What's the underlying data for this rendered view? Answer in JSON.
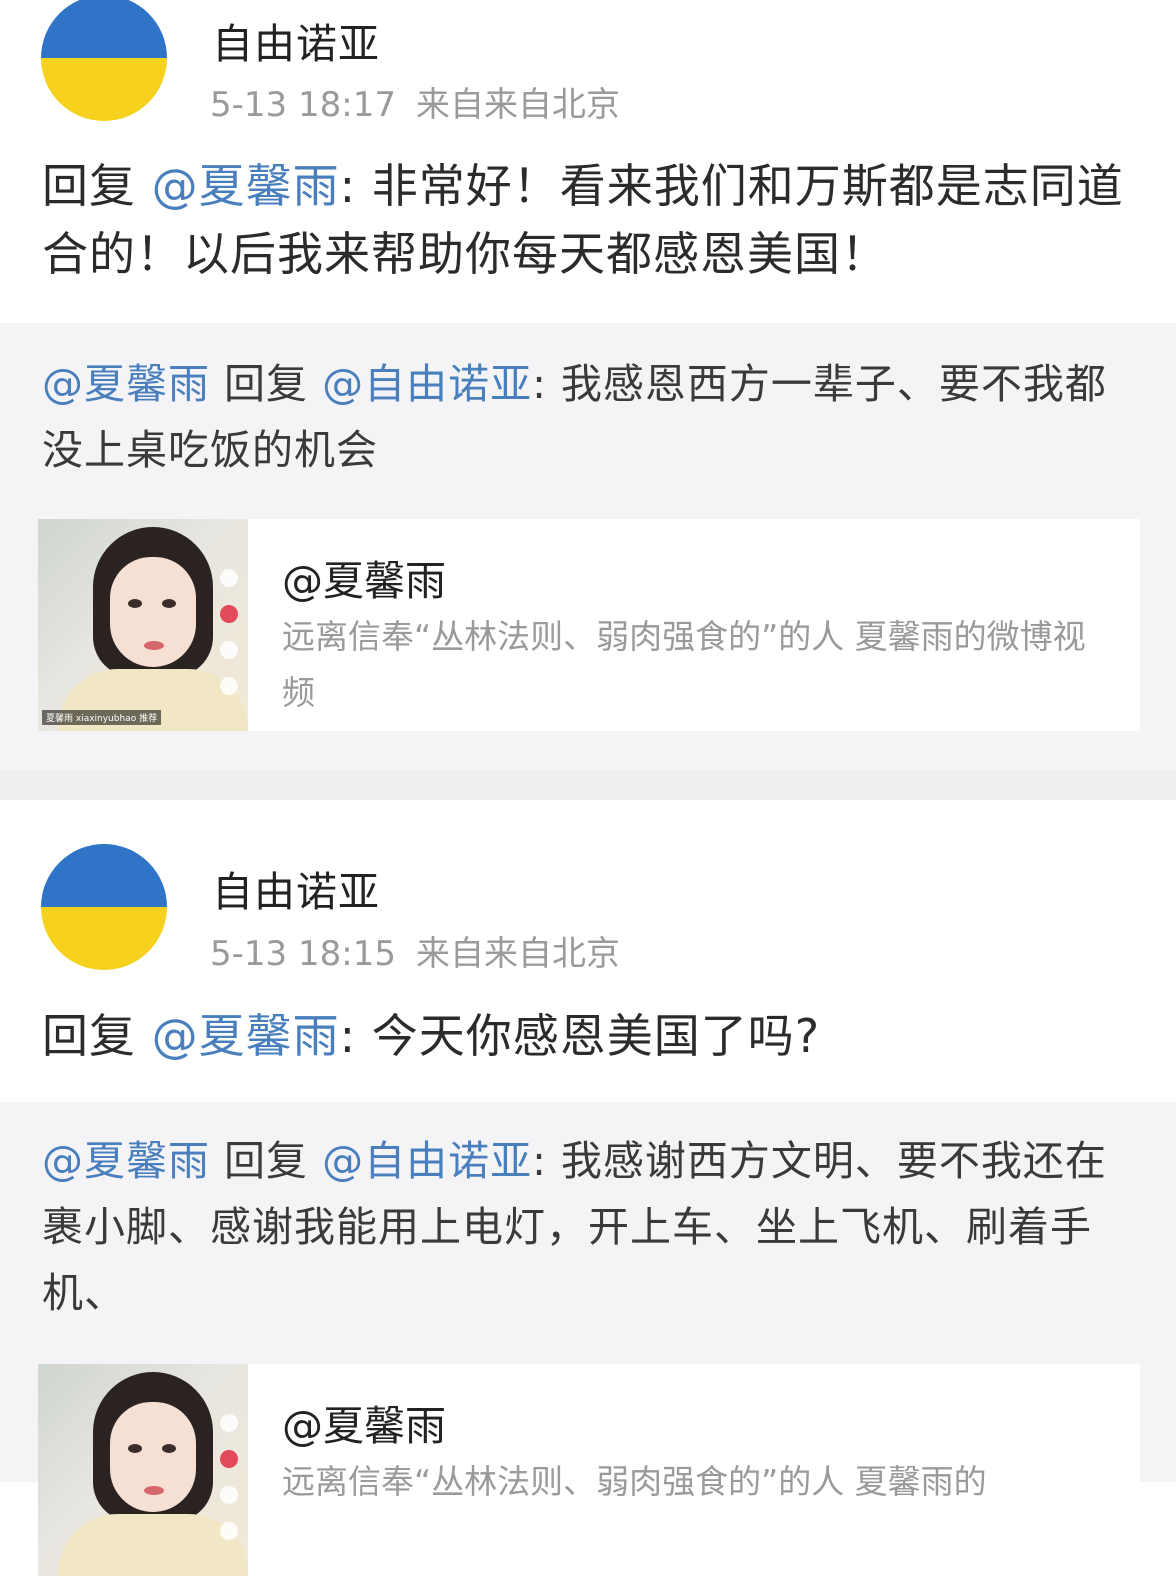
{
  "posts": [
    {
      "username": "自由诺亚",
      "time": "5-13 18:17",
      "source": "来自来自北京",
      "reply_prefix": "回复",
      "reply_mention": "@夏馨雨",
      "reply_body": ": 非常好！看来我们和万斯都是志同道合的！以后我来帮助你每天都感恩美国！",
      "quote_author": "@夏馨雨",
      "quote_mid": " 回复 ",
      "quote_mention": "@自由诺亚",
      "quote_body": ": 我感恩西方一辈子、要不我都没上桌吃饭的机会",
      "card_title": "@夏馨雨",
      "card_desc": "远离信奉“丛林法则、弱肉强食的”的人 夏馨雨的微博视频",
      "thumb_caption": "夏馨雨 xiaxinyubhao 推荐"
    },
    {
      "username": "自由诺亚",
      "time": "5-13 18:15",
      "source": "来自来自北京",
      "reply_prefix": "回复",
      "reply_mention": "@夏馨雨",
      "reply_body": ": 今天你感恩美国了吗?",
      "quote_author": "@夏馨雨",
      "quote_mid": " 回复 ",
      "quote_mention": "@自由诺亚",
      "quote_body": ": 我感谢西方文明、要不我还在裹小脚、感谢我能用上电灯，开上车、坐上飞机、刷着手机、",
      "card_title": "@夏馨雨",
      "card_desc": "远离信奉“丛林法则、弱肉强食的”的人 夏馨雨的",
      "thumb_caption": ""
    }
  ],
  "colors": {
    "mention": "#4a7fbd",
    "avatar_top": "#2f74c6",
    "avatar_bottom": "#f6d21f",
    "quote_bg": "#f4f4f6"
  }
}
